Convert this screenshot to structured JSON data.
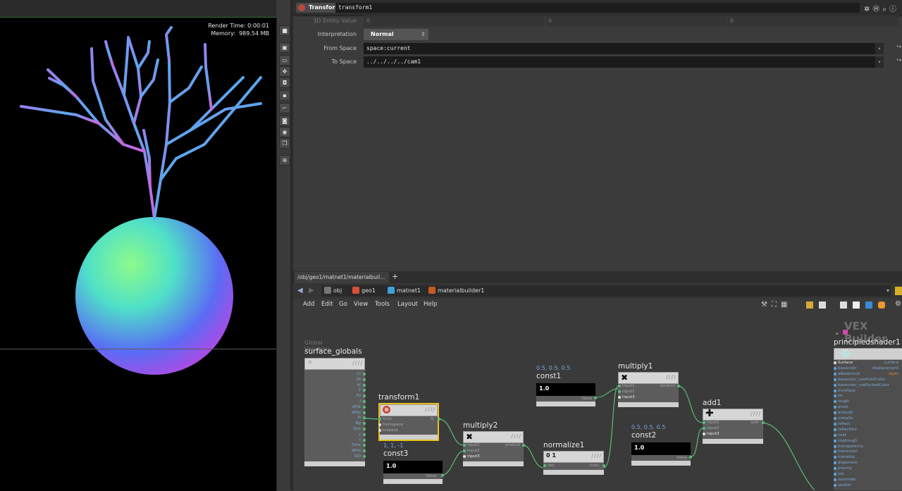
{
  "viewport": {
    "render_time": "Render Time: 0:00:01",
    "memory_label": "Memory:",
    "memory_value": "989.54 MB"
  },
  "params": {
    "node_type": "Transform",
    "node_name": "transform1",
    "rows": [
      {
        "label": "3D Entity Value",
        "values": [
          "0",
          "0",
          "0"
        ]
      },
      {
        "label": "Interpretation",
        "value": "Normal"
      },
      {
        "label": "From Space",
        "value": "space:current"
      },
      {
        "label": "To Space",
        "value": "../../../../cam1"
      }
    ]
  },
  "network": {
    "tab_label": "/obj/geo1/matnet1/materialbuil...",
    "breadcrumbs": [
      "obj",
      "geo1",
      "matnet1",
      "materialbuilder1"
    ],
    "menu": [
      "Add",
      "Edit",
      "Go",
      "View",
      "Tools",
      "Layout",
      "Help"
    ],
    "context_label": "VEX Builder",
    "nodes": {
      "surface_globals": {
        "caption": "Global Variables",
        "name": "surface_globals",
        "outputs": [
          "Cf",
          "Of",
          "Af",
          "P",
          "Pz",
          "I",
          "dPdt",
          "dPds",
          "N",
          "Ng",
          "Eye",
          "s",
          "t",
          "Time",
          "dPdz",
          "SID"
        ]
      },
      "transform1": {
        "name": "transform1",
        "inputs": [
          "from",
          "fromspace",
          "tospace"
        ],
        "output": "N"
      },
      "const3": {
        "label": "1, 1, -1",
        "name": "const3",
        "value": "1.0",
        "output": "Value"
      },
      "multiply2": {
        "name": "multiply2",
        "inputs": [
          "input1",
          "input2",
          "input3"
        ],
        "output": "product"
      },
      "const1": {
        "label": "0.5, 0.5, 0.5",
        "name": "const1",
        "value": "1.0",
        "output": "Value"
      },
      "normalize1": {
        "name": "normalize1",
        "input": "vec",
        "output": "nvec"
      },
      "multiply1": {
        "name": "multiply1",
        "inputs": [
          "input1",
          "input2",
          "input3"
        ],
        "output": "product"
      },
      "const2": {
        "label": "0.5, 0.5, 0.5",
        "name": "const2",
        "value": "1.0",
        "output": "Value"
      },
      "add1": {
        "name": "add1",
        "inputs": [
          "input1",
          "input2",
          "input3"
        ],
        "output": "sum"
      },
      "principledshader1": {
        "name": "principledshader1",
        "outputs": [
          "surface",
          "displacement",
          "layer"
        ],
        "inputs": [
          "Surface",
          "basecolor",
          "albedomult",
          "basecolor_usePointColor",
          "basecolor_usePackedColor",
          "frontface",
          "ior",
          "rough",
          "aniso",
          "anisodir",
          "metallic",
          "reflect",
          "reflecttint",
          "coat",
          "coatrough",
          "transparency",
          "transcolor",
          "transdist",
          "dispersion",
          "priority",
          "sss",
          "sssmodel",
          "sssdist"
        ]
      }
    }
  },
  "colors": {
    "wire": "#5dbb78",
    "selected_outline": "#e8c21a",
    "param_value": "#1a1a1a"
  }
}
